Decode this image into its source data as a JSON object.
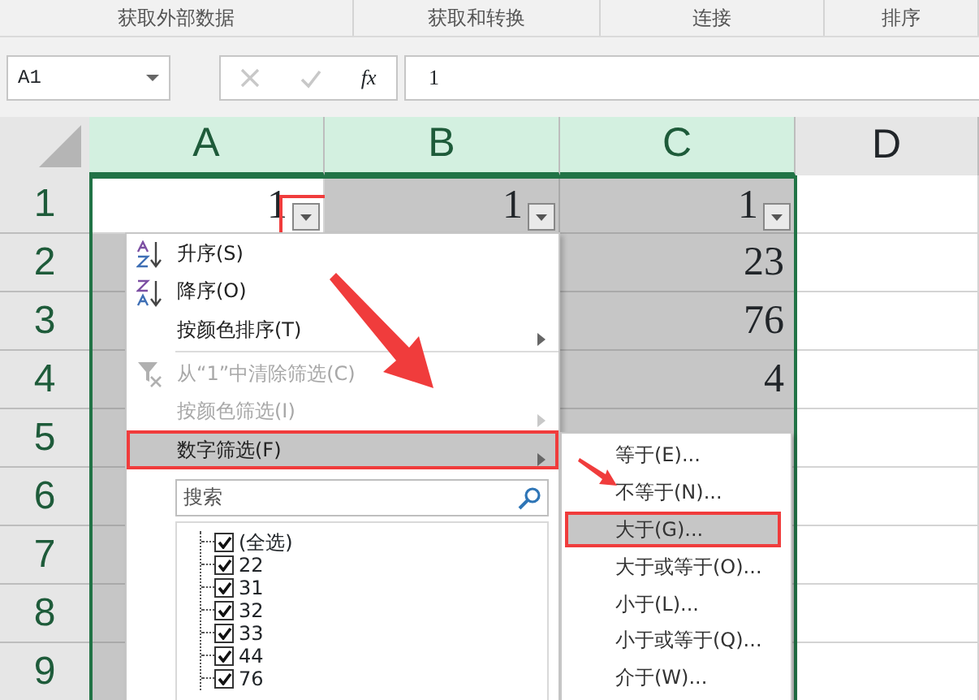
{
  "ribbon_groups": [
    "获取外部数据",
    "获取和转换",
    "连接",
    "排序"
  ],
  "name_box": {
    "value": "A1"
  },
  "formula_bar": {
    "fx": "fx",
    "value": "1"
  },
  "columns": [
    {
      "label": "A",
      "selected": true,
      "filter": true,
      "outlined": true
    },
    {
      "label": "B",
      "selected": true,
      "filter": true,
      "outlined": false
    },
    {
      "label": "C",
      "selected": true,
      "filter": true,
      "outlined": false
    },
    {
      "label": "D",
      "selected": false,
      "filter": false,
      "outlined": false
    }
  ],
  "rows": [
    {
      "label": "1",
      "cells": [
        {
          "text": "1",
          "shaded": false
        },
        {
          "text": "1",
          "shaded": true
        },
        {
          "text": "1",
          "shaded": true
        },
        {
          "shaded": false
        }
      ]
    },
    {
      "label": "2",
      "cells": [
        {
          "shaded": true
        },
        null,
        {
          "text": "23",
          "shaded": true
        },
        {
          "shaded": false
        }
      ]
    },
    {
      "label": "3",
      "cells": [
        {
          "shaded": true
        },
        null,
        {
          "text": "76",
          "shaded": true
        },
        {
          "shaded": false
        }
      ]
    },
    {
      "label": "4",
      "cells": [
        {
          "shaded": true
        },
        null,
        {
          "text": "4",
          "shaded": true
        },
        {
          "shaded": false
        }
      ]
    },
    {
      "label": "5",
      "cells": [
        {
          "shaded": true
        },
        null,
        {
          "shaded": true
        },
        {
          "shaded": false
        }
      ]
    },
    {
      "label": "6",
      "cells": [
        {
          "shaded": true
        },
        null,
        {
          "shaded": true
        },
        {
          "shaded": false
        }
      ]
    },
    {
      "label": "7",
      "cells": [
        {
          "shaded": true
        },
        null,
        {
          "shaded": true
        },
        {
          "shaded": false
        }
      ]
    },
    {
      "label": "8",
      "cells": [
        {
          "shaded": true
        },
        null,
        {
          "shaded": true
        },
        {
          "shaded": false
        }
      ]
    },
    {
      "label": "9",
      "cells": [
        {
          "shaded": true
        },
        null,
        {
          "shaded": true
        },
        {
          "shaded": false
        }
      ]
    }
  ],
  "filter_menu": {
    "items": [
      {
        "kind": "sort-asc",
        "label": "升序(S)",
        "disabled": false,
        "submenu": false,
        "selected": false
      },
      {
        "kind": "sort-desc",
        "label": "降序(O)",
        "disabled": false,
        "submenu": false,
        "selected": false
      },
      {
        "kind": "plain",
        "label": "按颜色排序(T)",
        "disabled": false,
        "submenu": true,
        "selected": false
      },
      {
        "kind": "separator"
      },
      {
        "kind": "clear-filter",
        "label": "从“1”中清除筛选(C)",
        "disabled": true,
        "submenu": false,
        "selected": false
      },
      {
        "kind": "plain",
        "label": "按颜色筛选(I)",
        "disabled": true,
        "submenu": true,
        "selected": false
      },
      {
        "kind": "plain",
        "label": "数字筛选(F)",
        "disabled": false,
        "submenu": true,
        "selected": true
      }
    ],
    "search": {
      "placeholder": "搜索"
    },
    "values": [
      {
        "label": "(全选)",
        "checked": true
      },
      {
        "label": "22",
        "checked": true
      },
      {
        "label": "31",
        "checked": true
      },
      {
        "label": "32",
        "checked": true
      },
      {
        "label": "33",
        "checked": true
      },
      {
        "label": "44",
        "checked": true
      },
      {
        "label": "76",
        "checked": true
      }
    ]
  },
  "number_filter_menu": {
    "items": [
      {
        "label": "等于(E)...",
        "selected": false
      },
      {
        "label": "不等于(N)...",
        "selected": false
      },
      {
        "label": "大于(G)...",
        "selected": true
      },
      {
        "label": "大于或等于(O)...",
        "selected": false
      },
      {
        "label": "小于(L)...",
        "selected": false
      },
      {
        "label": "小于或等于(Q)...",
        "selected": false
      },
      {
        "label": "介于(W)...",
        "selected": false
      }
    ]
  }
}
